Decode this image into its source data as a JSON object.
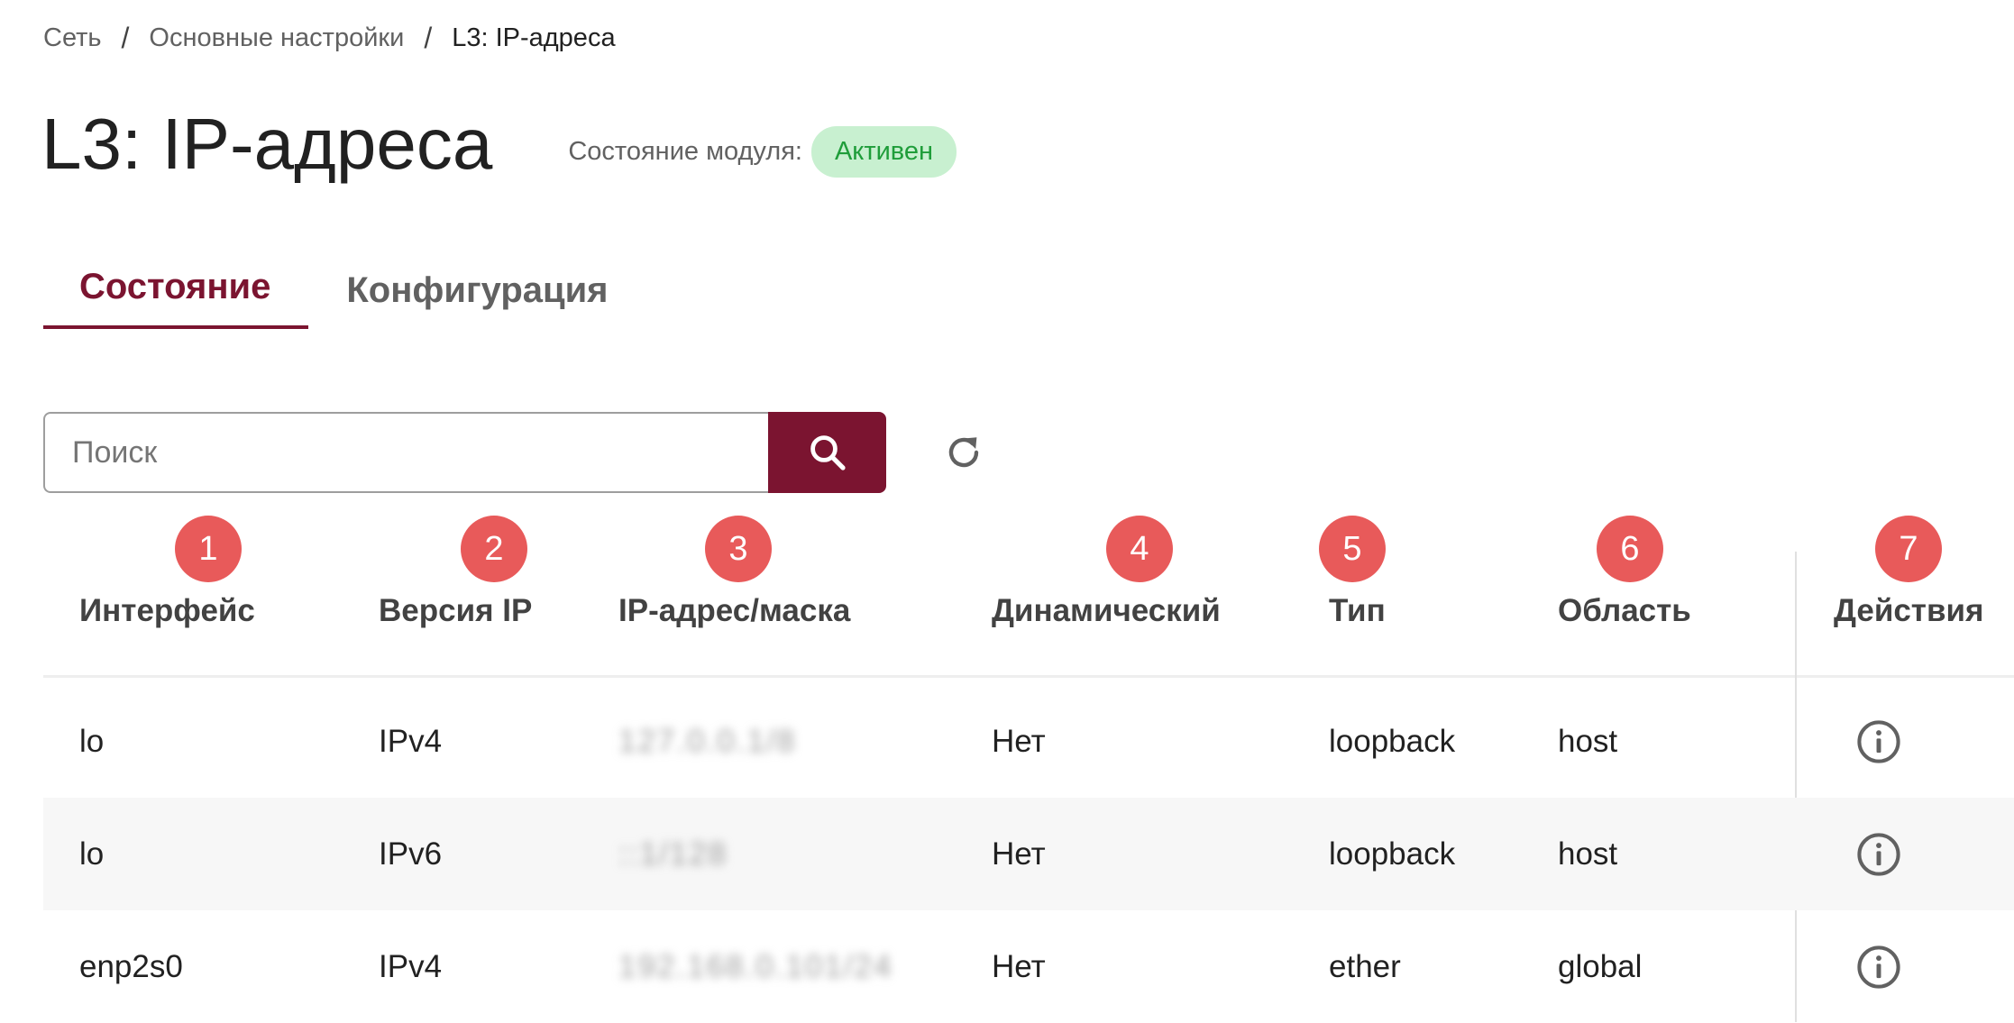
{
  "breadcrumb": {
    "items": [
      "Сеть",
      "Основные настройки",
      "L3: IP-адреса"
    ],
    "separator": "/"
  },
  "page": {
    "title": "L3: IP-адреса",
    "module_state_label": "Состояние модуля:",
    "module_state_value": "Активен"
  },
  "tabs": [
    {
      "label": "Состояние",
      "active": true
    },
    {
      "label": "Конфигурация",
      "active": false
    }
  ],
  "search": {
    "placeholder": "Поиск",
    "value": "",
    "button_icon": "search-icon",
    "refresh_icon": "refresh-icon"
  },
  "table": {
    "columns": [
      {
        "marker": "1",
        "label": "Интерфейс"
      },
      {
        "marker": "2",
        "label": "Версия IP"
      },
      {
        "marker": "3",
        "label": "IP-адрес/маска"
      },
      {
        "marker": "4",
        "label": "Динамический"
      },
      {
        "marker": "5",
        "label": "Тип"
      },
      {
        "marker": "6",
        "label": "Область"
      },
      {
        "marker": "7",
        "label": "Действия"
      }
    ],
    "rows": [
      {
        "interface": "lo",
        "ip_version": "IPv4",
        "ip_mask": "127.0.0.1/8",
        "dynamic": "Нет",
        "type": "loopback",
        "scope": "host",
        "action_icon": "info-icon"
      },
      {
        "interface": "lo",
        "ip_version": "IPv6",
        "ip_mask": "::1/128",
        "dynamic": "Нет",
        "type": "loopback",
        "scope": "host",
        "action_icon": "info-icon"
      },
      {
        "interface": "enp2s0",
        "ip_version": "IPv4",
        "ip_mask": "192.168.0.101/24",
        "dynamic": "Нет",
        "type": "ether",
        "scope": "global",
        "action_icon": "info-icon"
      }
    ]
  },
  "colors": {
    "accent": "#7b1430",
    "status_bg": "#c8f0d0",
    "status_text": "#1f9d3a",
    "marker": "#e85a5a"
  }
}
